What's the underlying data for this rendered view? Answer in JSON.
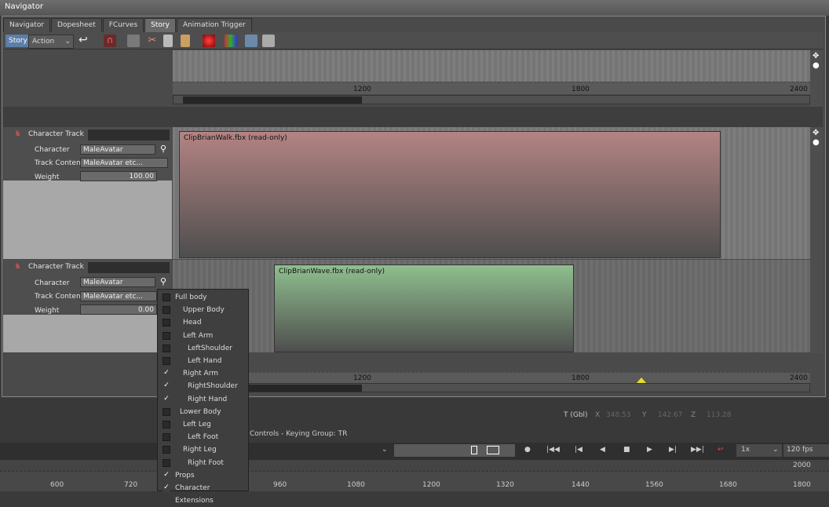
{
  "window": {
    "title": "Navigator"
  },
  "tabs": [
    "Navigator",
    "Dopesheet",
    "FCurves",
    "Story",
    "Animation Trigger"
  ],
  "toolbar": {
    "mode": "Story",
    "action": "Action"
  },
  "ruler_top": {
    "labels": [
      "1200",
      "1800",
      "2400"
    ]
  },
  "tracks": [
    {
      "header": "Character Track",
      "character_label": "Character",
      "character_value": "MaleAvatar",
      "content_label": "Track Content",
      "content_value": "MaleAvatar etc...",
      "weight_label": "Weight",
      "weight_value": "100.00",
      "clip": "ClipBrianWalk.fbx (read-only)"
    },
    {
      "header": "Character Track",
      "character_label": "Character",
      "character_value": "MaleAvatar",
      "content_label": "Track Content",
      "content_value": "MaleAvatar etc...",
      "weight_label": "Weight",
      "weight_value": "0.00",
      "clip": "ClipBrianWave.fbx (read-only)"
    }
  ],
  "ruler_bottom": {
    "labels": [
      "1200",
      "1800",
      "2400"
    ]
  },
  "menu": [
    {
      "label": "Full body",
      "checked": false
    },
    {
      "label": "Upper Body",
      "checked": false
    },
    {
      "label": "Head",
      "checked": false
    },
    {
      "label": "Left Arm",
      "checked": false
    },
    {
      "label": "LeftShoulder",
      "checked": false
    },
    {
      "label": "Left Hand",
      "checked": false
    },
    {
      "label": "Right Arm",
      "checked": true
    },
    {
      "label": "RightShoulder",
      "checked": true
    },
    {
      "label": "Right Hand",
      "checked": true
    },
    {
      "label": "Lower Body",
      "checked": false
    },
    {
      "label": "Left Leg",
      "checked": false
    },
    {
      "label": "Left Foot",
      "checked": false
    },
    {
      "label": "Right Leg",
      "checked": false
    },
    {
      "label": "Right Foot",
      "checked": false
    },
    {
      "label": "Props",
      "checked": true
    },
    {
      "label": "Character Extensions",
      "checked": true
    }
  ],
  "bottom": {
    "tgbl": "T (Gbl)",
    "x_label": "X",
    "x": "348.53",
    "y_label": "Y",
    "y": "142.67",
    "z_label": "Z",
    "z": "113.28",
    "status": "Controls  -  Keying Group: TR",
    "speed": "1x",
    "fps": "120 fps",
    "end_frame": "2000",
    "timeline_labels": [
      "600",
      "720",
      "960",
      "1080",
      "1200",
      "1320",
      "1440",
      "1560",
      "1680",
      "1800"
    ]
  }
}
